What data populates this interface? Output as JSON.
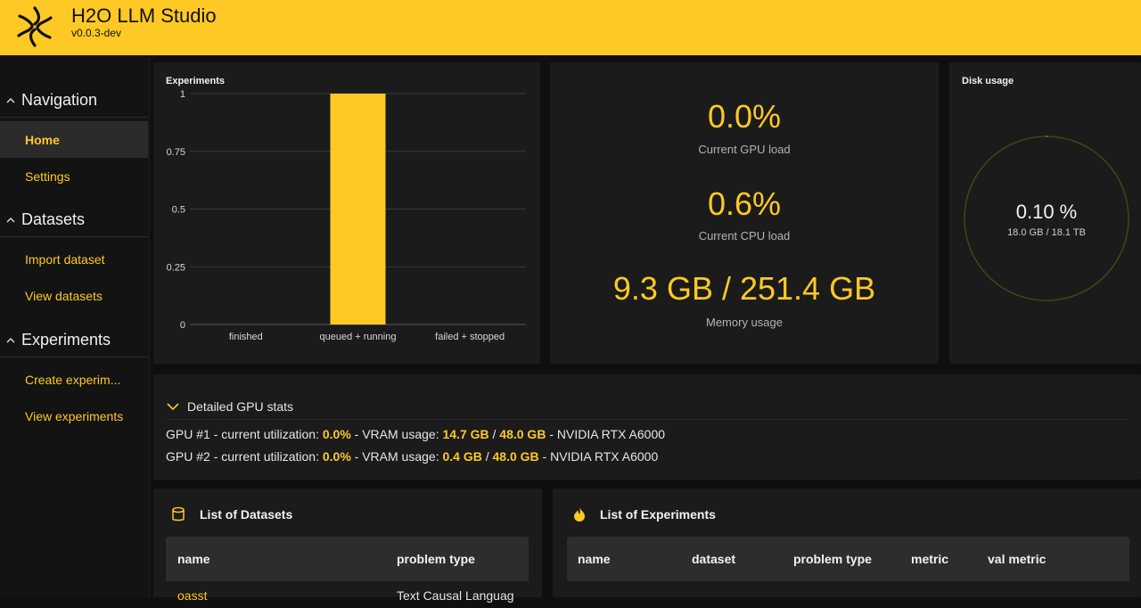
{
  "header": {
    "title": "H2O LLM Studio",
    "version": "v0.0.3-dev",
    "logo_icon": "h2o-logo-icon",
    "bg_color": "#fec925"
  },
  "sidebar": {
    "groups": [
      {
        "title": "Navigation",
        "items": [
          {
            "label": "Home",
            "active": true
          },
          {
            "label": "Settings"
          }
        ]
      },
      {
        "title": "Datasets",
        "items": [
          {
            "label": "Import dataset"
          },
          {
            "label": "View datasets"
          }
        ]
      },
      {
        "title": "Experiments",
        "items": [
          {
            "label": "Create experim..."
          },
          {
            "label": "View experiments"
          }
        ]
      }
    ]
  },
  "experiments_panel": {
    "title": "Experiments"
  },
  "chart_data": {
    "type": "bar",
    "title": "Experiments",
    "categories": [
      "finished",
      "queued + running",
      "failed + stopped"
    ],
    "values": [
      0,
      1,
      0
    ],
    "ylim": [
      0,
      1
    ],
    "yticks": [
      "0",
      "0.25",
      "0.5",
      "0.75",
      "1"
    ],
    "grid": true,
    "bar_color": "#fec925"
  },
  "system_stats": {
    "gpu_load": {
      "value": "0.0%",
      "label": "Current GPU load"
    },
    "cpu_load": {
      "value": "0.6%",
      "label": "Current CPU load"
    },
    "memory": {
      "value": "9.3 GB / 251.4 GB",
      "label": "Memory usage"
    }
  },
  "disk_usage": {
    "title": "Disk usage",
    "percent_text": "0.10 %",
    "detail": "18.0 GB / 18.1 TB",
    "fraction": 0.001
  },
  "gpu_stats": {
    "toggle_label": "Detailed GPU stats",
    "gpus": [
      {
        "prefix": "GPU #1 - current utilization: ",
        "util": "0.0%",
        "vram_text": " - VRAM usage: ",
        "vram_used": "14.7 GB",
        "sep": " / ",
        "vram_total": "48.0 GB",
        "suffix": " - NVIDIA RTX A6000"
      },
      {
        "prefix": "GPU #2 - current utilization: ",
        "util": "0.0%",
        "vram_text": " - VRAM usage: ",
        "vram_used": "0.4 GB",
        "sep": " / ",
        "vram_total": "48.0 GB",
        "suffix": " - NVIDIA RTX A6000"
      }
    ]
  },
  "datasets_list": {
    "title": "List of Datasets",
    "icon": "database-icon",
    "columns": [
      "name",
      "problem type"
    ],
    "rows": [
      {
        "name": "oasst",
        "problem_type": "Text Causal Languag"
      }
    ]
  },
  "experiments_list": {
    "title": "List of Experiments",
    "icon": "flame-icon",
    "columns": [
      "name",
      "dataset",
      "problem type",
      "metric",
      "val metric"
    ]
  }
}
